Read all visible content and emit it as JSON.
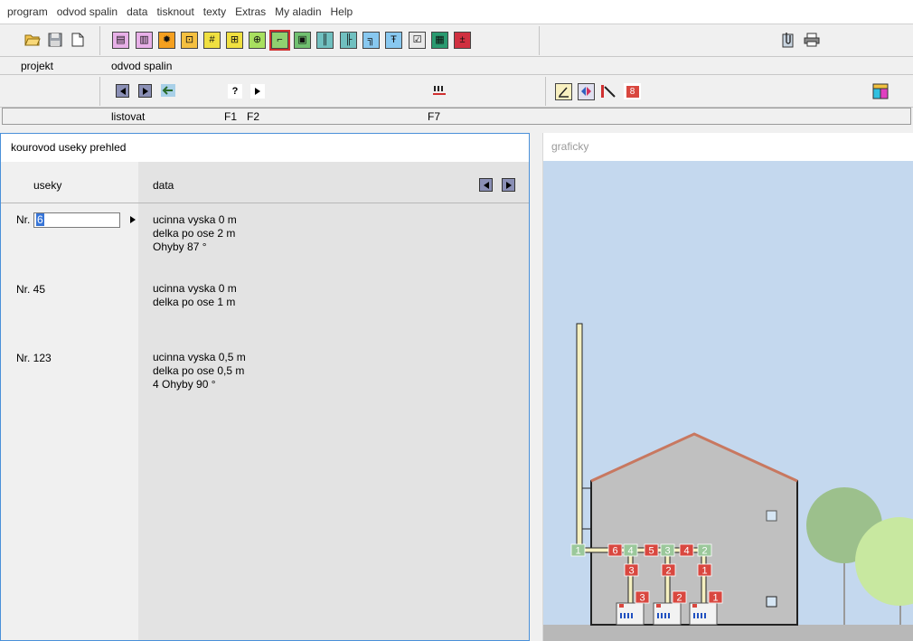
{
  "menu": [
    "program",
    "odvod spalin",
    "data",
    "tisknout",
    "texty",
    "Extras",
    "My aladin",
    "Help"
  ],
  "toolbar": {
    "file_icons": [
      "open-folder-icon",
      "save-disk-icon",
      "new-document-icon"
    ],
    "tool_icons": [
      {
        "name": "form-icon",
        "glyph": "▤",
        "color": "#e8b0e8"
      },
      {
        "name": "bar-chart-icon",
        "glyph": "▥",
        "color": "#e8b0e8"
      },
      {
        "name": "sun-burner-icon",
        "glyph": "✹",
        "color": "#f5a020"
      },
      {
        "name": "boiler-icon",
        "glyph": "⊡",
        "color": "#f5c040"
      },
      {
        "name": "hash-grid-icon",
        "glyph": "#",
        "color": "#f0e040"
      },
      {
        "name": "window-grid-icon",
        "glyph": "⊞",
        "color": "#f0e040"
      },
      {
        "name": "crosshair-icon",
        "glyph": "⊕",
        "color": "#a8e060"
      },
      {
        "name": "flue-path-icon",
        "glyph": "⌐",
        "color": "#90d070"
      },
      {
        "name": "chimney-section-icon",
        "glyph": "▣",
        "color": "#70c070"
      },
      {
        "name": "pipes-icon",
        "glyph": "║",
        "color": "#70c0c0"
      },
      {
        "name": "pipe-split-icon",
        "glyph": "╟",
        "color": "#70c0c0"
      },
      {
        "name": "pipe-bend-icon",
        "glyph": "╗",
        "color": "#88c8f0"
      },
      {
        "name": "pipe-top-icon",
        "glyph": "Ŧ",
        "color": "#88c8f0"
      },
      {
        "name": "checklist-icon",
        "glyph": "☑",
        "color": "#e8e8e8"
      },
      {
        "name": "calculator-icon",
        "glyph": "▦",
        "color": "#2a9a70"
      },
      {
        "name": "plus-minus-icon",
        "glyph": "±",
        "color": "#d03040"
      }
    ],
    "right_icons": [
      "attachment-icon",
      "printer-icon"
    ]
  },
  "tabs": {
    "projekt": "projekt",
    "odvod": "odvod spalin"
  },
  "navbar": {
    "help_glyph": "?",
    "f7_badge": "8"
  },
  "keys": {
    "listovat": "listovat",
    "f1": "F1",
    "f2": "F2",
    "f7": "F7"
  },
  "left_panel": {
    "title": "kourovod useky prehled",
    "col_useky": "useky",
    "col_data": "data",
    "input_prefix": "Nr.",
    "input_value": "6",
    "rows": [
      {
        "nr": "Nr. 45",
        "lines": [
          "ucinna vyska 0 m",
          "delka po ose 1 m"
        ]
      },
      {
        "nr": "Nr. 123",
        "lines": [
          "ucinna vyska 0,5 m",
          "delka po ose 0,5 m",
          "4 Ohyby 90 °"
        ]
      }
    ],
    "first_row_lines": [
      "ucinna vyska 0 m",
      "delka po ose 2 m",
      "Ohyby 87 °"
    ]
  },
  "right_panel": {
    "title": "graficky",
    "flue_labels": {
      "top": [
        "1",
        "6",
        "4",
        "5",
        "3",
        "4",
        "2"
      ],
      "mid": [
        "3",
        "2",
        "1"
      ],
      "bottom": [
        "3",
        "2",
        "1"
      ]
    }
  },
  "colors": {
    "sky": "#c4d8ee",
    "house": "#c0c0c0",
    "roof": "#c87860",
    "ground": "#b8b8b8",
    "red_tag": "#d9473f",
    "green_tag": "#9bc89b",
    "pipe": "#f5f0c0",
    "tree_dark": "#9cc08c",
    "tree_light": "#c8e8a0"
  }
}
